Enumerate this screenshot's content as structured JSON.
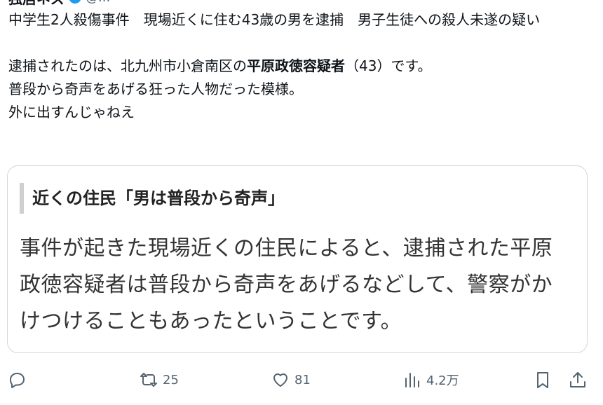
{
  "tweet": {
    "author_name": "独居ネズ",
    "handle": "@...",
    "headline": "中学生2人殺傷事件　現場近くに住む43歳の男を逮捕　男子生徒への殺人未遂の疑い",
    "line1_pre": "逮捕されたのは、北九州市小倉南区の",
    "line1_bold": "平原政徳容疑者",
    "line1_post": "（43）です。",
    "line2": "普段から奇声をあげる狂った人物だった模様。",
    "line3": "外に出すんじゃねえ"
  },
  "card": {
    "heading": "近くの住民「男は普段から奇声」",
    "body": "事件が起きた現場近くの住民によると、逮捕された平原政徳容疑者は普段から奇声をあげるなどして、警察がかけつけることもあったということです。"
  },
  "actions": {
    "reply_count": "",
    "retweet_count": "25",
    "like_count": "81",
    "views_count": "4.2万"
  },
  "icons": {
    "reply": "reply-icon",
    "retweet": "retweet-icon",
    "like": "heart-icon",
    "views": "analytics-icon",
    "bookmark": "bookmark-icon",
    "share": "share-icon"
  },
  "colors": {
    "text": "#0f1419",
    "muted": "#536471",
    "border": "#cfd9de",
    "verified": "#1d9bf0"
  }
}
